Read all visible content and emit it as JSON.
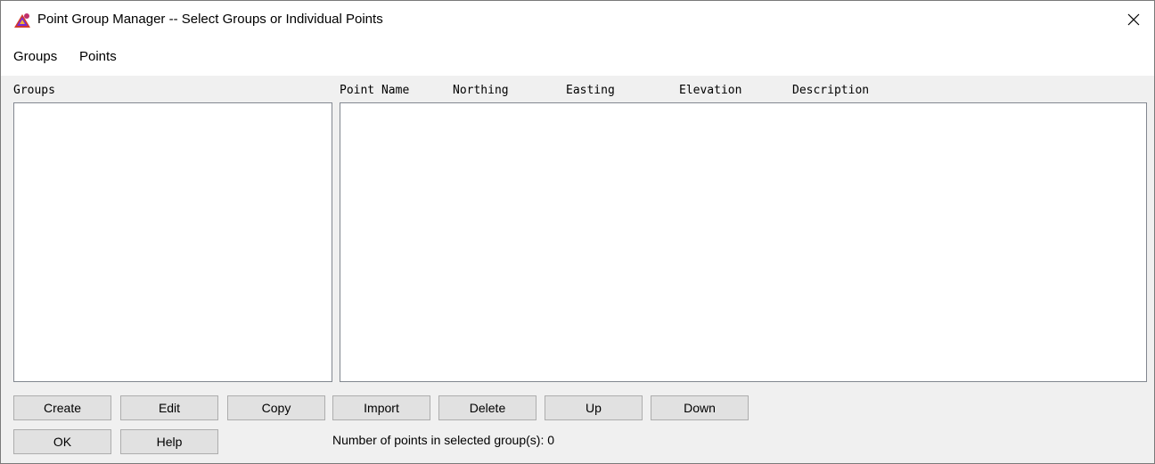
{
  "window": {
    "title": "Point Group Manager -- Select Groups or Individual Points",
    "close_glyph": "✕"
  },
  "menu": {
    "items": [
      "Groups",
      "Points"
    ]
  },
  "groups_panel": {
    "label": "Groups",
    "items": []
  },
  "points_panel": {
    "columns": [
      "Point Name",
      "Northing",
      "Easting",
      "Elevation",
      "Description"
    ],
    "rows": []
  },
  "buttons": {
    "create": "Create",
    "edit": "Edit",
    "copy": "Copy",
    "import": "Import",
    "delete": "Delete",
    "up": "Up",
    "down": "Down",
    "ok": "OK",
    "help": "Help"
  },
  "status": {
    "text": "Number of points in selected group(s):  0"
  },
  "icons": {
    "app": "app-logo-icon",
    "close": "close-icon"
  },
  "colors": {
    "dialog_bg": "#f0f0f0",
    "button_bg": "#e1e1e1",
    "list_bg": "#ffffff"
  }
}
